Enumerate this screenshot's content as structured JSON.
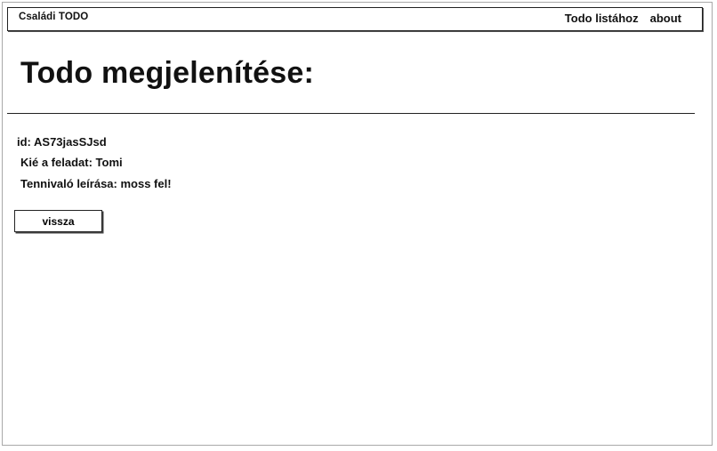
{
  "navbar": {
    "brand": "Családi TODO",
    "links": [
      {
        "label": "Todo listához"
      },
      {
        "label": "about"
      }
    ]
  },
  "page": {
    "title": "Todo megjelenítése:"
  },
  "todo": {
    "id_line": "id: AS73jasSJsd",
    "owner_line": "Kié a feladat: Tomi",
    "description_line": "Tennivaló leírása: moss fel!"
  },
  "actions": {
    "back_label": "vissza"
  }
}
